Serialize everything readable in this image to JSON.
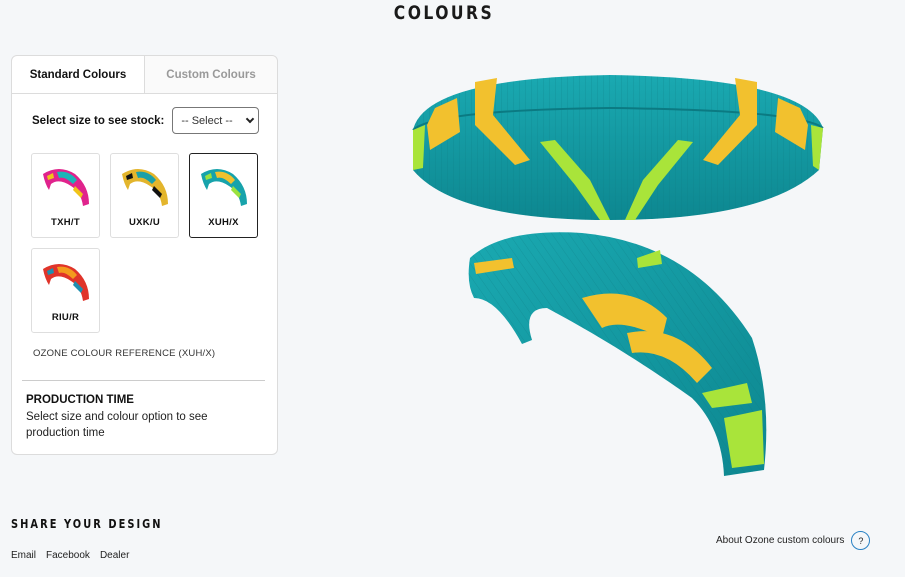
{
  "page": {
    "title": "COLOURS"
  },
  "tabs": [
    {
      "label": "Standard Colours",
      "active": true
    },
    {
      "label": "Custom Colours",
      "active": false
    }
  ],
  "size_selector": {
    "label": "Select size to see stock:",
    "value": "-- Select --"
  },
  "swatches": [
    {
      "code": "TXH/T",
      "selected": false,
      "colors": {
        "main": "#e0238c",
        "accent": "#1ab5b8",
        "stripe": "#f0c419"
      }
    },
    {
      "code": "UXK/U",
      "selected": false,
      "colors": {
        "main": "#e3b52c",
        "accent": "#1aa0a8",
        "stripe": "#111111"
      }
    },
    {
      "code": "XUH/X",
      "selected": true,
      "colors": {
        "main": "#17a3ab",
        "accent": "#f2c12e",
        "stripe": "#9be23f"
      }
    },
    {
      "code": "RIU/R",
      "selected": false,
      "colors": {
        "main": "#e0342a",
        "accent": "#f39a1e",
        "stripe": "#1f8fb0"
      }
    }
  ],
  "reference": "OZONE COLOUR REFERENCE (XUH/X)",
  "production": {
    "title": "PRODUCTION TIME",
    "text": "Select size and colour option to see production time"
  },
  "share": {
    "title": "SHARE YOUR DESIGN",
    "links": [
      "Email",
      "Facebook",
      "Dealer"
    ]
  },
  "about": {
    "label": "About Ozone custom colours",
    "icon_text": "?"
  },
  "wing_colors": {
    "main": "#17a3ab",
    "dark": "#0f8a91",
    "yellow": "#f2c12e",
    "lime": "#a9e43a"
  }
}
